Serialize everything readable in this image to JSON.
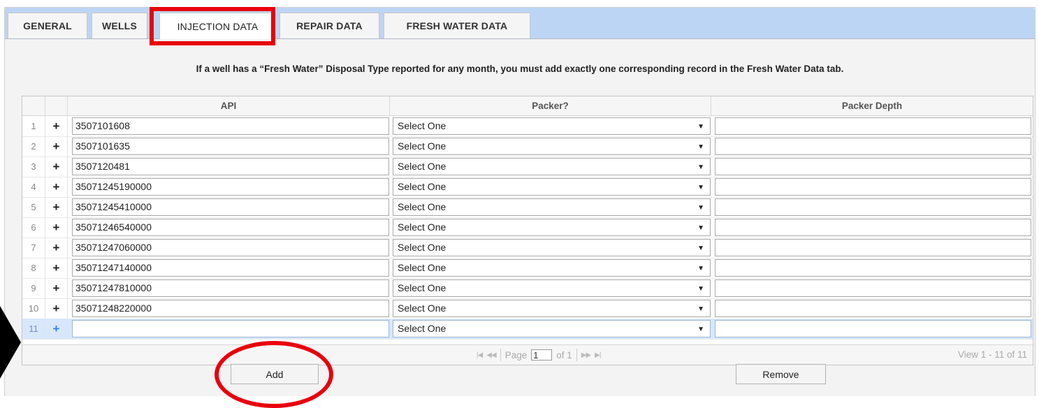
{
  "tabs": [
    {
      "label": "GENERAL",
      "active": false
    },
    {
      "label": "WELLS",
      "active": false
    },
    {
      "label": "INJECTION DATA",
      "active": true
    },
    {
      "label": "REPAIR DATA",
      "active": false
    },
    {
      "label": "FRESH WATER DATA",
      "active": false
    }
  ],
  "notice": "If a well has a “Fresh Water” Disposal Type reported for any month, you must add exactly one corresponding record in the Fresh Water Data tab.",
  "grid": {
    "columns": [
      "API",
      "Packer?",
      "Packer Depth"
    ],
    "rows": [
      {
        "num": "1",
        "api": "3507101608",
        "packer": "Select One",
        "depth": ""
      },
      {
        "num": "2",
        "api": "3507101635",
        "packer": "Select One",
        "depth": ""
      },
      {
        "num": "3",
        "api": "3507120481",
        "packer": "Select One",
        "depth": ""
      },
      {
        "num": "4",
        "api": "35071245190000",
        "packer": "Select One",
        "depth": ""
      },
      {
        "num": "5",
        "api": "35071245410000",
        "packer": "Select One",
        "depth": ""
      },
      {
        "num": "6",
        "api": "35071246540000",
        "packer": "Select One",
        "depth": ""
      },
      {
        "num": "7",
        "api": "35071247060000",
        "packer": "Select One",
        "depth": ""
      },
      {
        "num": "8",
        "api": "35071247140000",
        "packer": "Select One",
        "depth": ""
      },
      {
        "num": "9",
        "api": "35071247810000",
        "packer": "Select One",
        "depth": ""
      },
      {
        "num": "10",
        "api": "35071248220000",
        "packer": "Select One",
        "depth": ""
      },
      {
        "num": "11",
        "api": "",
        "packer": "Select One",
        "depth": "",
        "selected": true
      }
    ],
    "plus_symbol": "+",
    "dropdown_arrow": "▼"
  },
  "pager": {
    "first_icon": "|◀",
    "prev_icon": "◀◀",
    "page_label": "Page",
    "page_value": "1",
    "of_label": "of 1",
    "next_icon": "▶▶",
    "last_icon": "▶|",
    "view_text": "View 1 - 11 of 11"
  },
  "buttons": {
    "add": "Add",
    "remove": "Remove"
  },
  "colors": {
    "tab_bar": "#bdd5f4",
    "highlight": "#e8000b",
    "selected_row": "#d9e7fb"
  }
}
